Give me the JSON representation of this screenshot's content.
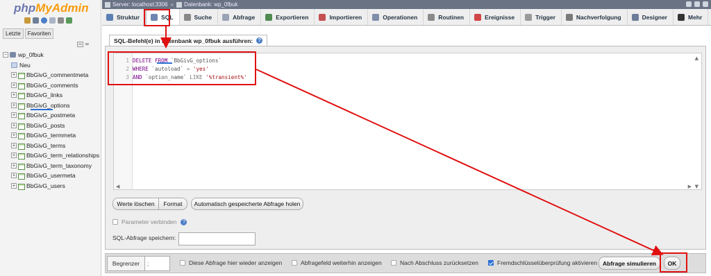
{
  "app": {
    "logo_php": "php",
    "logo_my": "MyAdmin"
  },
  "nav": {
    "tabs": [
      "Letzte",
      "Favoriten"
    ],
    "database": "wp_0fbuk",
    "new_label": "Neu",
    "tables": [
      "BbGivG_commentmeta",
      "BbGivG_comments",
      "BbGivG_links",
      "BbGivG_options",
      "BbGivG_postmeta",
      "BbGivG_posts",
      "BbGivG_termmeta",
      "BbGivG_terms",
      "BbGivG_term_relationships",
      "BbGivG_term_taxonomy",
      "BbGivG_usermeta",
      "BbGivG_users"
    ]
  },
  "breadcrumb": {
    "server": "Server: localhost:3306",
    "separator": "»",
    "database": "Datenbank: wp_0fbuk"
  },
  "menu": {
    "tabs": [
      {
        "label": "Struktur",
        "icon": "structure-icon",
        "color": "#5b7fb3"
      },
      {
        "label": "SQL",
        "icon": "sql-icon",
        "color": "#6f86b0"
      },
      {
        "label": "Suche",
        "icon": "search-icon",
        "color": "#888888"
      },
      {
        "label": "Abfrage",
        "icon": "query-icon",
        "color": "#9aa3b5"
      },
      {
        "label": "Exportieren",
        "icon": "export-icon",
        "color": "#4f8a4f"
      },
      {
        "label": "Importieren",
        "icon": "import-icon",
        "color": "#c45050"
      },
      {
        "label": "Operationen",
        "icon": "wrench-icon",
        "color": "#7f8faa"
      },
      {
        "label": "Routinen",
        "icon": "routines-icon",
        "color": "#8a8a8a"
      },
      {
        "label": "Ereignisse",
        "icon": "clock-icon",
        "color": "#d04545"
      },
      {
        "label": "Trigger",
        "icon": "trigger-icon",
        "color": "#9a9a9a"
      },
      {
        "label": "Nachverfolgung",
        "icon": "eye-icon",
        "color": "#7a7a7a"
      },
      {
        "label": "Designer",
        "icon": "designer-icon",
        "color": "#6c7c98"
      },
      {
        "label": "Mehr",
        "icon": "chevron-down-icon",
        "color": "#333333"
      }
    ]
  },
  "sql": {
    "legend": "SQL-Befehl(e) in Datenbank wp_0fbuk ausführen:",
    "lines": [
      {
        "n": "1",
        "k": "DELETE FROM ",
        "a": "`BbGivG_options`",
        "o": "",
        "b": ""
      },
      {
        "n": "2",
        "k": "WHERE ",
        "a": "`autoload`",
        "o": " = ",
        "b": "'yes'"
      },
      {
        "n": "3",
        "k": "AND ",
        "a": "`option_name`",
        "o": " LIKE ",
        "b": "'%transient%'"
      }
    ],
    "buttons": {
      "clear": "Werte löschen",
      "format": "Format",
      "restore": "Automatisch gespeicherte Abfrage holen"
    },
    "bind_params": "Parameter verbinden",
    "save_label": "SQL-Abfrage speichern:",
    "save_value": ""
  },
  "footer": {
    "delimiter_label": "Begrenzer",
    "delimiter_value": ";",
    "checks": [
      {
        "label": "Diese Abfrage hier wieder anzeigen",
        "checked": false
      },
      {
        "label": "Abfragefeld weiterhin anzeigen",
        "checked": false
      },
      {
        "label": "Nach Abschluss zurücksetzen",
        "checked": false
      },
      {
        "label": "Fremdschlüsselüberprüfung aktivieren",
        "checked": true
      }
    ],
    "simulate": "Abfrage simulieren",
    "ok": "OK"
  },
  "colors": {
    "annotation": "#e01010",
    "highlight": "#2b6fd4"
  }
}
